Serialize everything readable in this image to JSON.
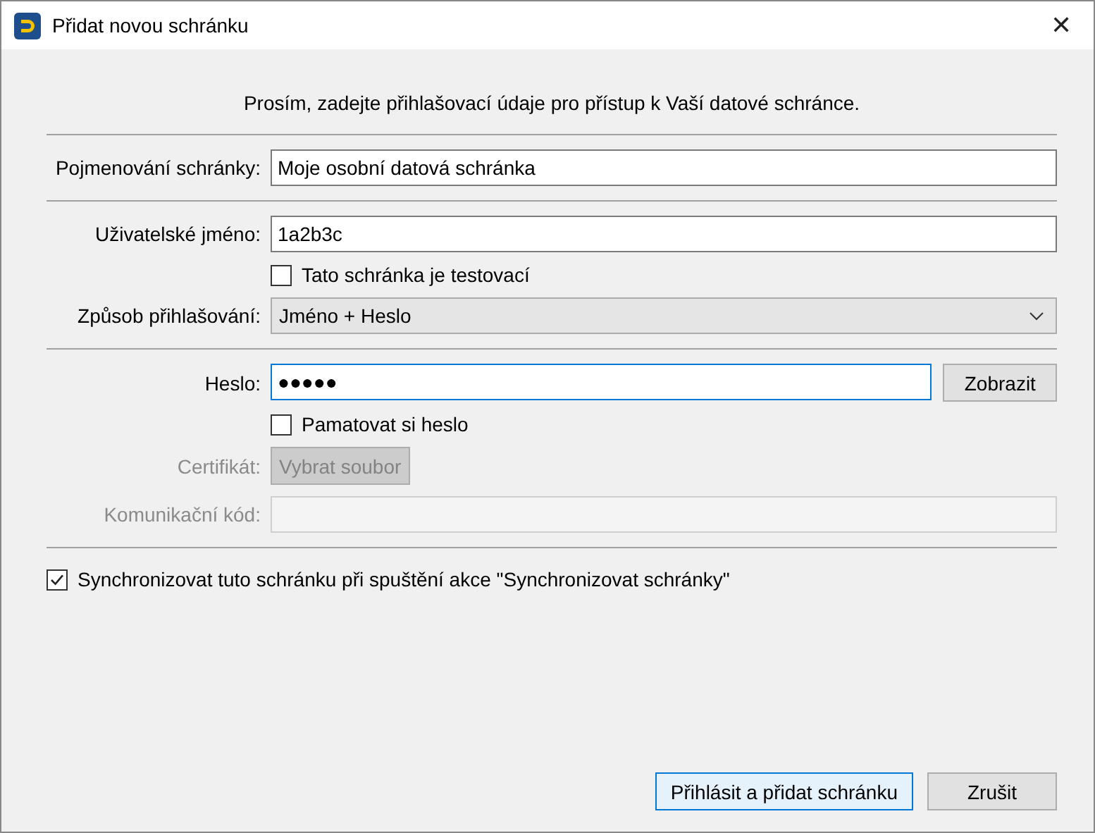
{
  "window": {
    "title": "Přidat novou schránku",
    "close": "✕"
  },
  "intro": "Prosím, zadejte přihlašovací údaje pro přístup k Vaší datové schránce.",
  "sections": [
    [
      {
        "kind": "text",
        "label": "Pojmenování schránky:",
        "value": "Moje osobní datová schránka",
        "disabled": false,
        "focused": false
      }
    ],
    [
      {
        "kind": "text",
        "label": "Uživatelské jméno:",
        "value": "1a2b3c",
        "disabled": false,
        "focused": false
      },
      {
        "kind": "checkbox",
        "text": "Tato schránka je testovací",
        "checked": false
      },
      {
        "kind": "select",
        "label": "Způsob přihlašování:",
        "value": "Jméno + Heslo",
        "disabled": false
      }
    ],
    [
      {
        "kind": "password",
        "label": "Heslo:",
        "value": "●●●●●",
        "button": "Zobrazit",
        "disabled": false,
        "focused": true
      },
      {
        "kind": "checkbox",
        "text": "Pamatovat si heslo",
        "checked": false
      },
      {
        "kind": "file",
        "label": "Certifikát:",
        "button": "Vybrat soubor",
        "disabled": true
      },
      {
        "kind": "text",
        "label": "Komunikační kód:",
        "disabled": true,
        "focused": false
      }
    ]
  ],
  "sync": {
    "text": "Synchronizovat tuto schránku při spuštění akce \"Synchronizovat schránky\"",
    "checked": true
  },
  "buttons": [
    {
      "label": "Přihlásit a přidat schránku",
      "default": true
    },
    {
      "label": "Zrušit",
      "default": false
    }
  ]
}
